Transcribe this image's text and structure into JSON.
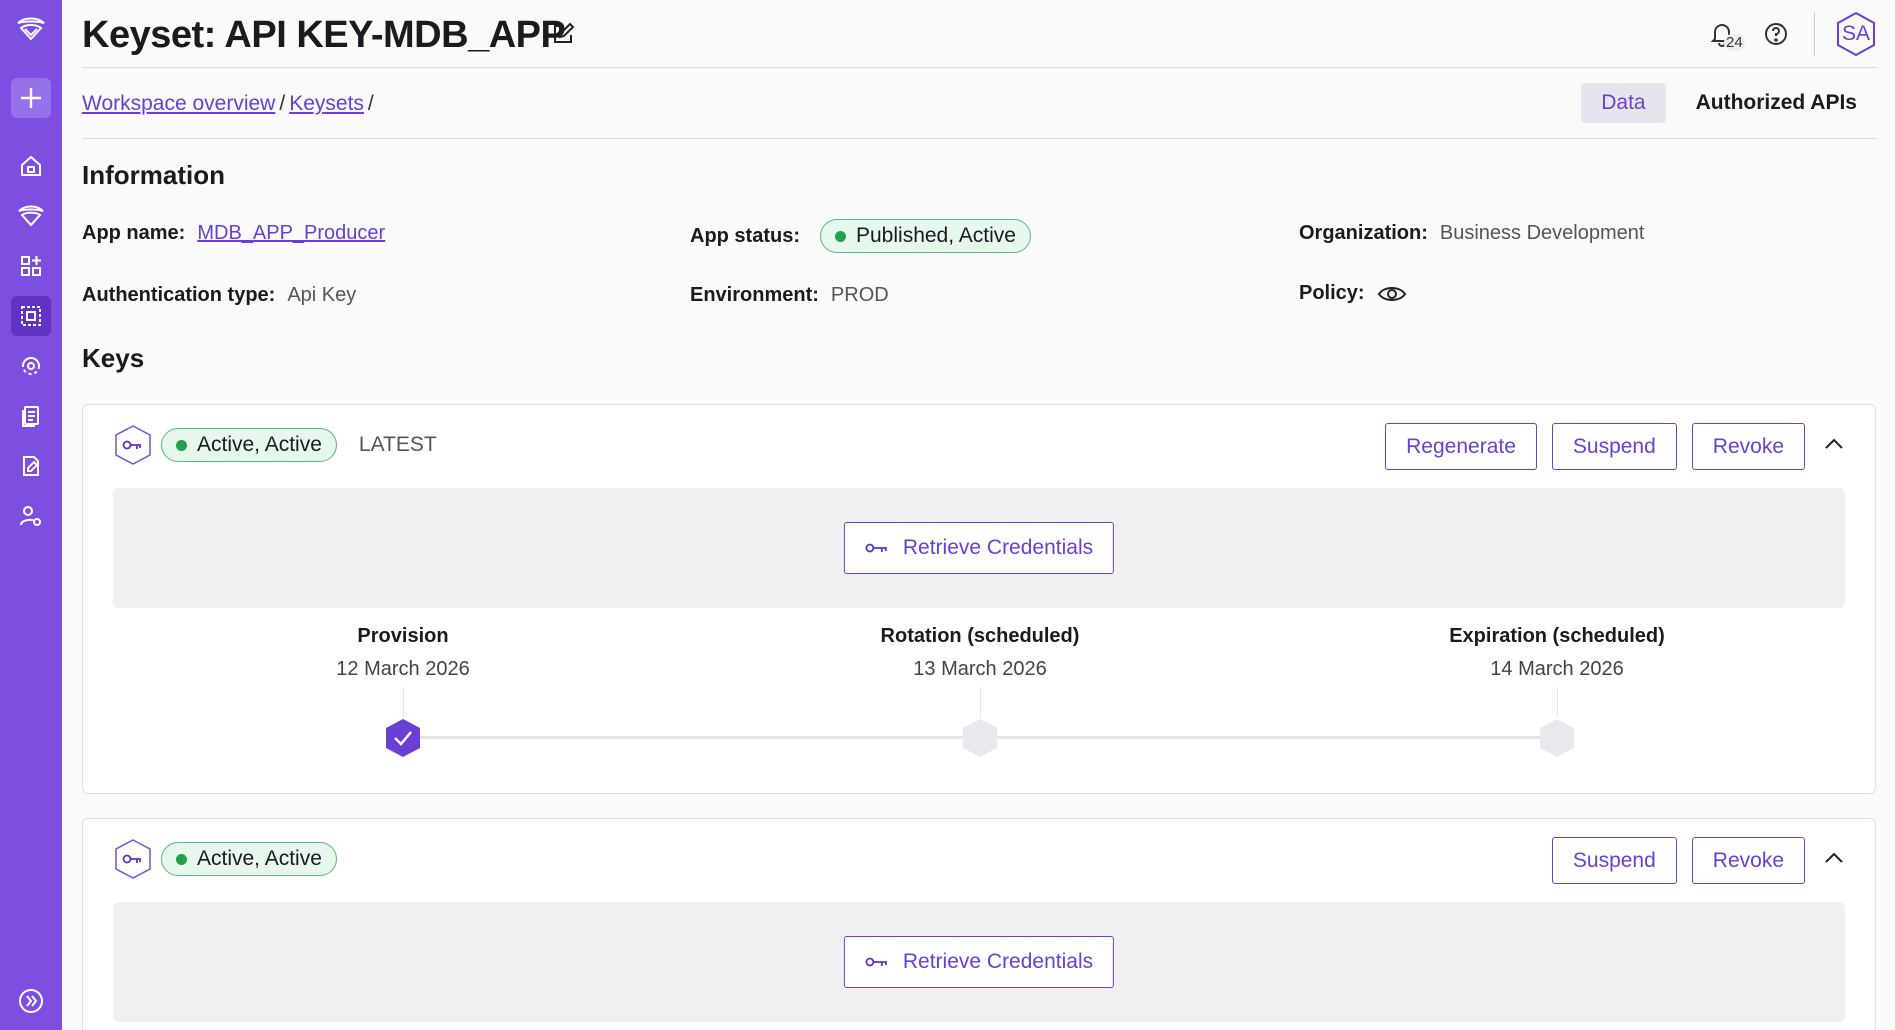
{
  "header": {
    "title": "Keyset: API KEY-MDB_APP",
    "notifications_count": "24",
    "avatar_initials": "SA"
  },
  "breadcrumb": {
    "items": [
      "Workspace overview",
      "Keysets"
    ],
    "separator": "/"
  },
  "tabs": [
    "Data",
    "Authorized APIs"
  ],
  "information": {
    "title": "Information",
    "app_name_label": "App name:",
    "app_name_value": "MDB_APP_Producer",
    "app_status_label": "App status:",
    "app_status_value": "Published, Active",
    "organization_label": "Organization:",
    "organization_value": "Business Development",
    "auth_type_label": "Authentication type:",
    "auth_type_value": "Api Key",
    "environment_label": "Environment:",
    "environment_value": "PROD",
    "policy_label": "Policy:"
  },
  "keys": {
    "title": "Keys",
    "cards": [
      {
        "status": "Active, Active",
        "tag": "LATEST",
        "actions": [
          "Regenerate",
          "Suspend",
          "Revoke"
        ],
        "retrieve_label": "Retrieve Credentials",
        "timeline": [
          {
            "title": "Provision",
            "date": "12 March 2026",
            "done": true
          },
          {
            "title": "Rotation (scheduled)",
            "date": "13 March 2026",
            "done": false
          },
          {
            "title": "Expiration (scheduled)",
            "date": "14 March 2026",
            "done": false
          }
        ]
      },
      {
        "status": "Active, Active",
        "actions": [
          "Suspend",
          "Revoke"
        ],
        "retrieve_label": "Retrieve Credentials"
      }
    ]
  },
  "colors": {
    "sidebar": "#7c4fe0",
    "accent": "#6a3fd6",
    "success": "#22a04b"
  }
}
